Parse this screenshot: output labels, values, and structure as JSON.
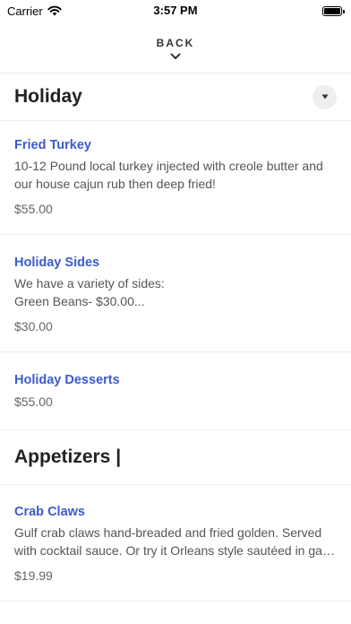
{
  "status_bar": {
    "carrier": "Carrier",
    "time": "3:57 PM"
  },
  "nav": {
    "back_label": "BACK"
  },
  "sections": [
    {
      "title": "Holiday",
      "items": [
        {
          "name": "Fried Turkey",
          "description": "10-12 Pound local turkey injected with creole butter and our house cajun rub then deep fried!",
          "price": "$55.00"
        },
        {
          "name": "Holiday Sides",
          "description": "We have a variety of sides:\nGreen Beans- $30.00...",
          "price": "$30.00"
        },
        {
          "name": "Holiday Desserts",
          "price": "$55.00"
        }
      ]
    },
    {
      "title": "Appetizers |",
      "items": [
        {
          "name": "Crab Claws",
          "description_line1": "Gulf crab claws hand-breaded and fried golden. Served",
          "description_line2": "with cocktail sauce. Or try it Orleans style sautéed in garlic butter.",
          "price": "$19.99"
        }
      ]
    }
  ]
}
